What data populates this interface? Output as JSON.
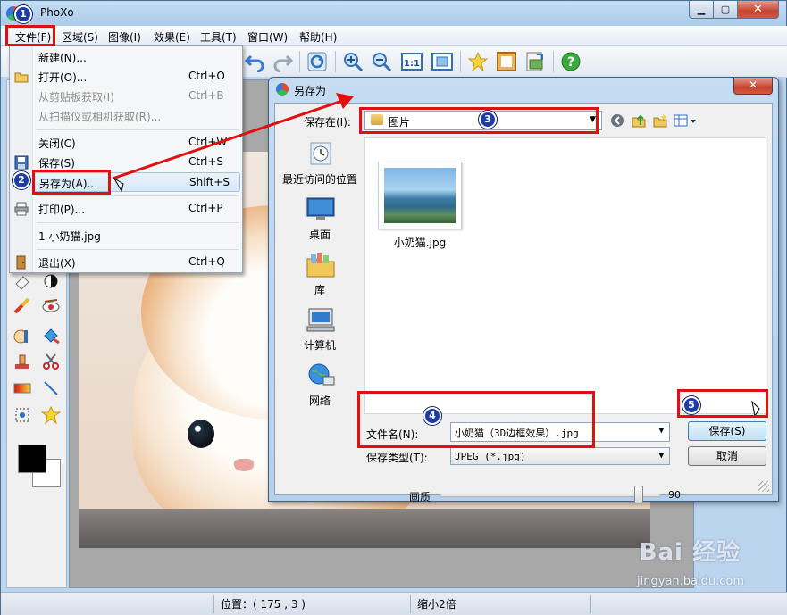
{
  "window": {
    "title": "PhoXo"
  },
  "menubar": {
    "items": [
      {
        "label": "文件(F)"
      },
      {
        "label": "区域(S)"
      },
      {
        "label": "图像(I)"
      },
      {
        "label": "效果(E)"
      },
      {
        "label": "工具(T)"
      },
      {
        "label": "窗口(W)"
      },
      {
        "label": "帮助(H)"
      }
    ]
  },
  "file_menu": {
    "items": [
      {
        "label": "新建(N)...",
        "shortcut": "",
        "enabled": true
      },
      {
        "label": "打开(O)...",
        "shortcut": "Ctrl+O",
        "enabled": true
      },
      {
        "label": "从剪贴板获取(I)",
        "shortcut": "Ctrl+B",
        "enabled": false
      },
      {
        "label": "从扫描仪或相机获取(R)...",
        "shortcut": "",
        "enabled": false
      },
      {
        "label": "关闭(C)",
        "shortcut": "Ctrl+W",
        "enabled": true
      },
      {
        "label": "保存(S)",
        "shortcut": "Ctrl+S",
        "enabled": true
      },
      {
        "label": "另存为(A)...",
        "shortcut": "Shift+S",
        "enabled": true,
        "highlighted": true
      },
      {
        "label": "打印(P)...",
        "shortcut": "Ctrl+P",
        "enabled": true
      },
      {
        "label": "1 小奶猫.jpg",
        "shortcut": "",
        "enabled": true
      },
      {
        "label": "退出(X)",
        "shortcut": "Ctrl+Q",
        "enabled": true
      }
    ]
  },
  "save_dialog": {
    "title": "另存为",
    "save_in_label": "保存在(I):",
    "save_in_value": "图片",
    "places": [
      {
        "label": "最近访问的位置",
        "icon": "recent-places-icon"
      },
      {
        "label": "桌面",
        "icon": "desktop-icon"
      },
      {
        "label": "库",
        "icon": "libraries-icon"
      },
      {
        "label": "计算机",
        "icon": "computer-icon"
      },
      {
        "label": "网络",
        "icon": "network-icon"
      }
    ],
    "files": [
      {
        "name": "小奶猫.jpg"
      }
    ],
    "filename_label": "文件名(N):",
    "filename_value": "小奶猫（3D边框效果）.jpg",
    "filetype_label": "保存类型(T):",
    "filetype_value": "JPEG (*.jpg)",
    "save_button": "保存(S)",
    "cancel_button": "取消",
    "quality_label": "画质",
    "quality_value": "90",
    "quality_fraction": 0.9
  },
  "statusbar": {
    "position": "位置：( 175 , 3 )",
    "zoom": "缩小2倍"
  },
  "annotations": {
    "steps": [
      "1",
      "2",
      "3",
      "4",
      "5"
    ]
  },
  "watermark": {
    "brand": "Bai 经验",
    "url": "jingyan.baidu.com"
  },
  "colors": {
    "annotation_red": "#e01010",
    "badge_blue": "#1d3da6",
    "foreground_color": "#000000",
    "background_color": "#ffffff"
  }
}
